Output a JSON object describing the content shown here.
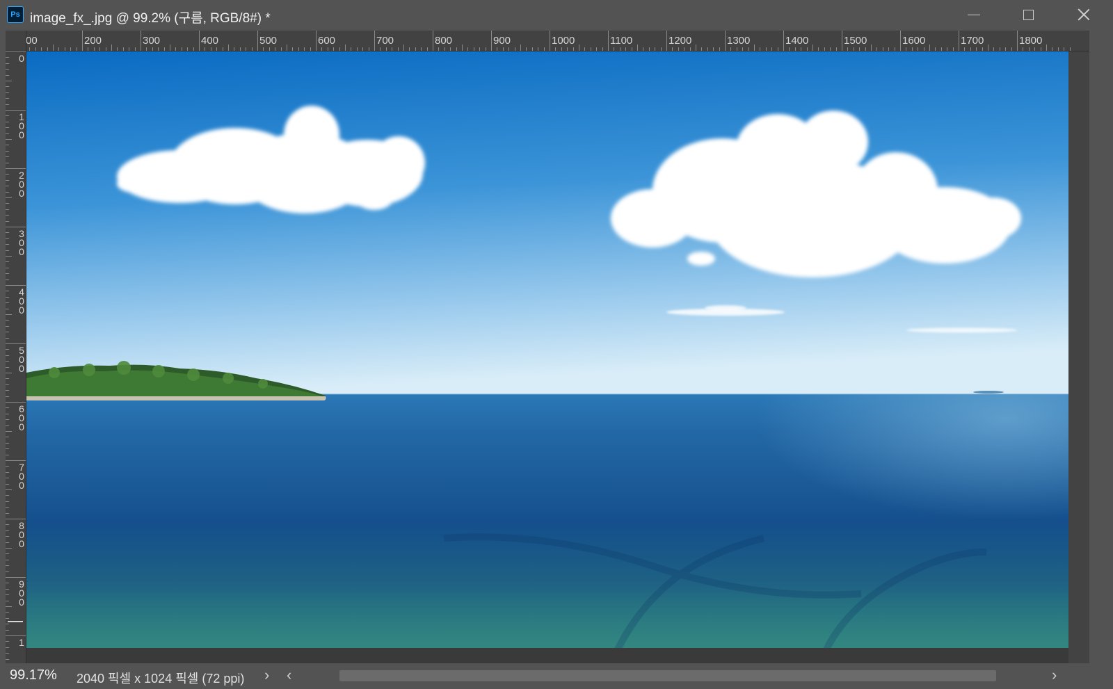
{
  "window": {
    "app_icon": "Ps",
    "title": "image_fx_.jpg @ 99.2% (구름, RGB/8#) *",
    "controls": {
      "minimize": "minimize-icon",
      "maximize": "maximize-icon",
      "close": "close-icon"
    }
  },
  "rulers": {
    "horizontal_labels": [
      "00",
      "200",
      "300",
      "400",
      "500",
      "600",
      "700",
      "800",
      "900",
      "1000",
      "1100",
      "1200",
      "1300",
      "1400",
      "1500",
      "1600",
      "1700",
      "1800"
    ],
    "vertical_labels": [
      "0",
      "100",
      "200",
      "300",
      "400",
      "500",
      "600",
      "700",
      "800",
      "900",
      "1"
    ]
  },
  "canvas": {
    "image_description_colors": {
      "sky_top": "#0c6fc4",
      "sky_horizon": "#d6ebf7",
      "sea_horizon": "#2a77b5",
      "sea_deep": "#0c3f76",
      "shallow": "#2f7f86"
    }
  },
  "status": {
    "zoom": "99.17%",
    "doc_info": "2040 픽셀 x 1024 픽셀 (72 ppi)",
    "expand_chevron": "›",
    "scroll_left": "‹",
    "scroll_right": "›"
  }
}
